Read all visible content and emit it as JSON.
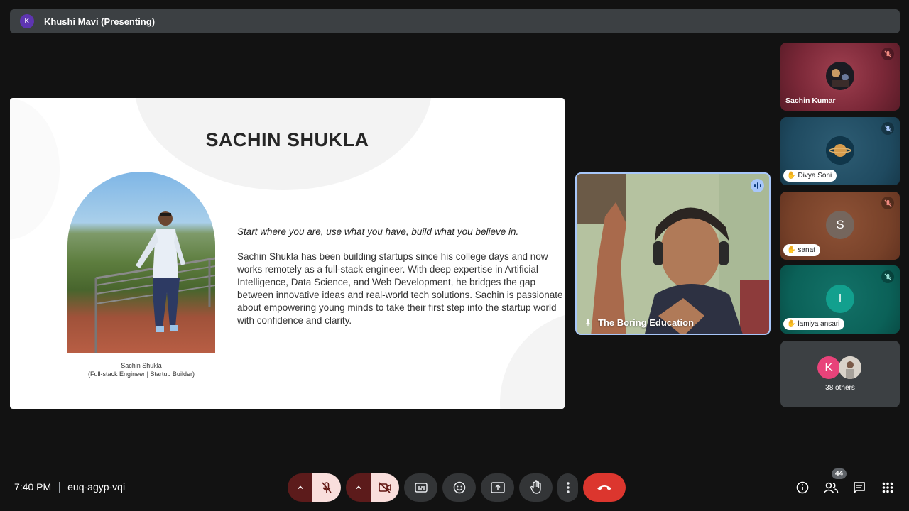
{
  "topbar": {
    "avatar_letter": "K",
    "title": "Khushi Mavi (Presenting)"
  },
  "slide": {
    "heading": "SACHIN SHUKLA",
    "caption_name": "Sachin Shukla",
    "caption_role": "(Full-stack Engineer | Startup Builder)",
    "quote": "Start where you are, use what you have, build what you believe in.",
    "bio": "Sachin Shukla has been building startups since his college days and now works remotely as a full-stack engineer. With deep expertise in Artificial Intelligence, Data Science, and Web Development, he bridges the gap between innovative ideas and real-world tech solutions. Sachin is passionate about empowering young minds to take their first step into the startup world with confidence and clarity."
  },
  "speaker": {
    "name": "The Boring Education"
  },
  "participants": [
    {
      "name": "Sachin Kumar",
      "muted": true,
      "hand": false
    },
    {
      "name": "Divya Soni",
      "muted": true,
      "hand": true
    },
    {
      "name": "sanat",
      "muted": true,
      "hand": true,
      "initial": "S",
      "color": "#75665d"
    },
    {
      "name": "lamiya ansari",
      "muted": true,
      "hand": true,
      "initial": "l",
      "color": "#12a08e"
    }
  ],
  "others": {
    "initial": "K",
    "color": "#e8437a",
    "label": "38 others"
  },
  "bottombar": {
    "time": "7:40 PM",
    "meeting_code": "euq-agyp-vqi",
    "people_count": "44"
  },
  "icons": {
    "mic": "mic-off-icon",
    "cam": "camera-off-icon",
    "captions": "captions-icon",
    "emoji": "emoji-icon",
    "present": "present-screen-icon",
    "hand": "raise-hand-icon",
    "more": "more-vertical-icon",
    "end": "end-call-icon",
    "info": "info-icon",
    "people": "people-icon",
    "chat": "chat-icon",
    "activities": "activities-icon"
  },
  "colors": {
    "end_call": "#dc362e",
    "mic_off_bg": "#f9dedc",
    "speaker_border": "#a8c7fa"
  }
}
